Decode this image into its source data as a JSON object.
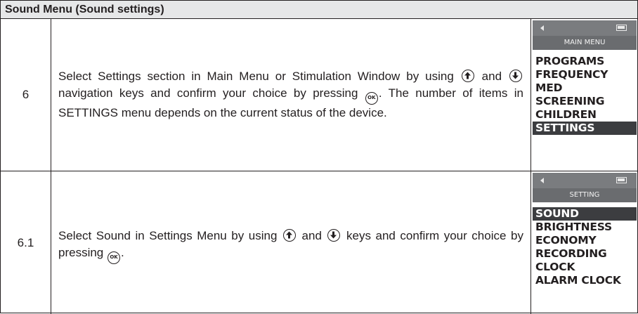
{
  "header": {
    "title": "Sound Menu (Sound settings)"
  },
  "rows": [
    {
      "step": "6",
      "text": {
        "a": "Select Settings section in Main Menu or Stimulation Window by using",
        "b": "and",
        "c": "navigation keys and confirm your choice by pressing",
        "d": ". The number of items in SETTINGS menu depends on the current status of the device."
      },
      "screen": {
        "title": "MAIN MENU",
        "items": [
          "PROGRAMS",
          "FREQUENCY",
          "MED",
          "SCREENING",
          "CHILDREN",
          "SETTINGS"
        ],
        "selected_item": "SETTINGS"
      }
    },
    {
      "step": "6.1",
      "text": {
        "a": "Select Sound in Settings Menu by using",
        "b": "and",
        "c": "keys and confirm your choice by pressing",
        "d": "."
      },
      "screen": {
        "title": "SETTING",
        "items": [
          "SOUND",
          "BRIGHTNESS",
          "ECONOMY",
          "RECORDING",
          "CLOCK",
          "ALARM CLOCK"
        ],
        "selected_item": "SOUND"
      }
    }
  ],
  "key_labels": {
    "ok": "OK"
  },
  "icons": {
    "up": "up-arrow-key-icon",
    "down": "down-arrow-key-icon",
    "ok": "ok-key-icon",
    "back": "back-arrow-icon",
    "battery": "battery-icon"
  },
  "colors": {
    "header_bg": "#e6e7e8",
    "status_bar": "#7a7c7f",
    "title_bar": "#6a6c6f",
    "selected_bg": "#3c3d40"
  }
}
